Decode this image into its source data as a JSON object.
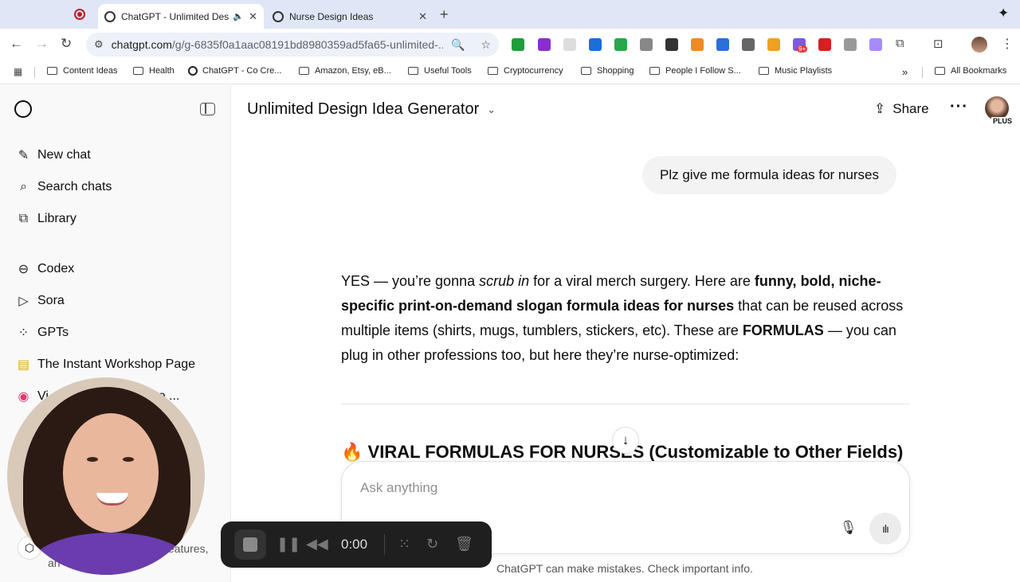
{
  "browser": {
    "tabs": [
      {
        "title": "ChatGPT - Unlimited Design Idea Generator",
        "active": true
      },
      {
        "title": "Nurse Design Ideas",
        "active": false
      }
    ],
    "url_host": "chatgpt.com",
    "url_path": "/g/g-6835f0a1aac08191bd8980359ad5fa65-unlimited-...",
    "bookmarks": [
      "Content Ideas",
      "Health",
      "ChatGPT - Co Cre...",
      "Amazon, Etsy, eB...",
      "Useful Tools",
      "Cryptocurrency",
      "Shopping",
      "People I Follow S...",
      "Music Playlists"
    ],
    "all_bookmarks": "All Bookmarks",
    "extension_badge": "9+"
  },
  "sidebar": {
    "items": [
      {
        "label": "New chat",
        "icon": "compose-icon"
      },
      {
        "label": "Search chats",
        "icon": "search-icon"
      },
      {
        "label": "Library",
        "icon": "library-icon"
      },
      {
        "label": "Codex",
        "icon": "codex-icon"
      },
      {
        "label": "Sora",
        "icon": "play-icon"
      },
      {
        "label": "GPTs",
        "icon": "grid-icon"
      },
      {
        "label": "The Instant Workshop Page",
        "icon": "notebook-icon"
      },
      {
        "label": "Video ...",
        "icon": "video-app-icon"
      }
    ],
    "partial_item_prefix": "Vi",
    "upgrade_text_1": "features,",
    "upgrade_text_2": "an"
  },
  "header": {
    "title": "Unlimited Design Idea Generator",
    "share_label": "Share",
    "plan_badge": "PLUS"
  },
  "conversation": {
    "user_message": "Plz give me formula ideas for nurses",
    "assistant": {
      "p1_a": "YES — you’re gonna ",
      "p1_em": "scrub in",
      "p1_b": " for a viral merch surgery. Here are ",
      "p1_strong": "funny, bold, niche-specific print-on-demand slogan formula ideas for nurses",
      "p1_c": " that can be reused across multiple items (shirts, mugs, tumblers, stickers, etc). These are ",
      "p1_strong2": "FORMULAS",
      "p1_d": " — you can plug in other professions too, but here they’re nurse-optimized:"
    },
    "heading_emoji": "🔥",
    "heading": "VIRAL FORMULAS FOR NURSES (Customizable to Other Fields)"
  },
  "composer": {
    "placeholder": "Ask anything",
    "disclaimer": "ChatGPT can make mistakes. Check important info."
  },
  "recorder": {
    "time": "0:00"
  },
  "colors": {
    "tabbar": "#dfe6f6",
    "sidebar": "#f9f9f9",
    "user_bubble": "#f3f3f3",
    "recorder": "#1f1f1f",
    "record_red": "#c2182a"
  }
}
